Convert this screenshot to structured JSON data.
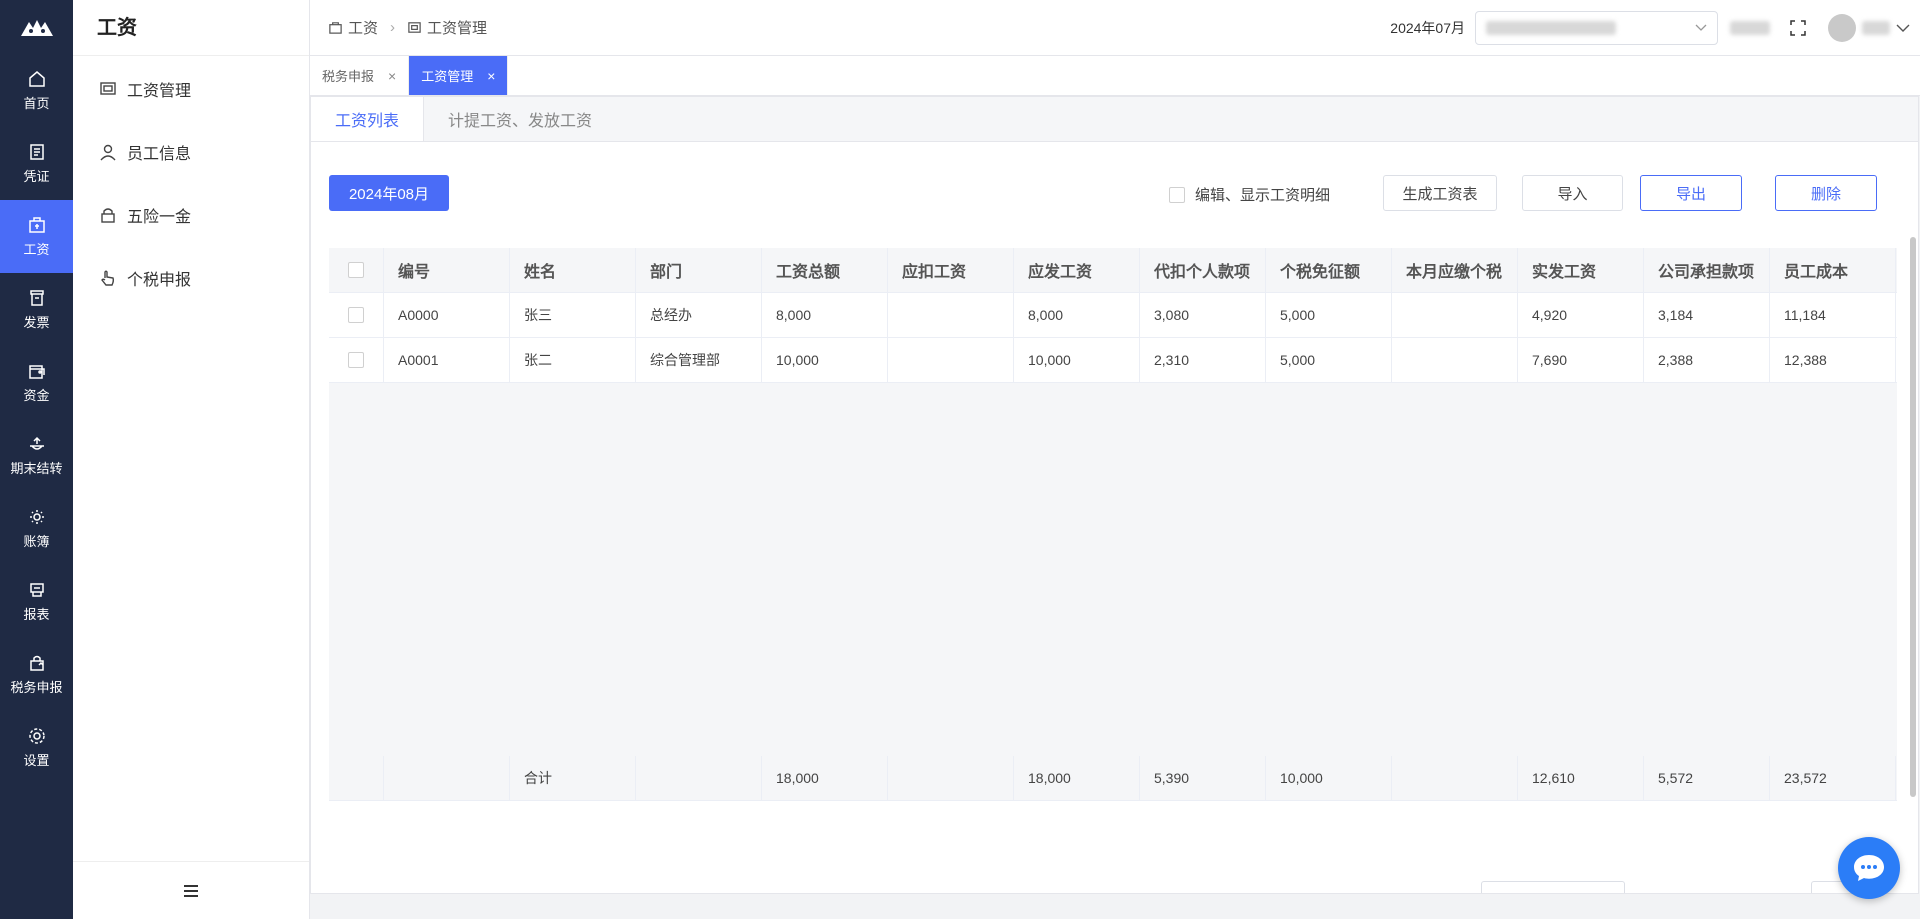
{
  "rail": {
    "items": [
      {
        "label": "首页",
        "icon": "home-icon"
      },
      {
        "label": "凭证",
        "icon": "voucher-icon"
      },
      {
        "label": "工资",
        "icon": "salary-icon"
      },
      {
        "label": "发票",
        "icon": "invoice-icon"
      },
      {
        "label": "资金",
        "icon": "funds-icon"
      },
      {
        "label": "期末结转",
        "icon": "period-close-icon"
      },
      {
        "label": "账簿",
        "icon": "ledger-icon"
      },
      {
        "label": "报表",
        "icon": "report-icon"
      },
      {
        "label": "税务申报",
        "icon": "tax-filing-icon"
      },
      {
        "label": "设置",
        "icon": "settings-icon"
      }
    ],
    "active_index": 2
  },
  "submenu": {
    "title": "工资",
    "items": [
      {
        "label": "工资管理",
        "icon": "payroll-icon"
      },
      {
        "label": "员工信息",
        "icon": "user-icon"
      },
      {
        "label": "五险一金",
        "icon": "lock-icon"
      },
      {
        "label": "个税申报",
        "icon": "hand-pointer-icon"
      }
    ]
  },
  "header": {
    "breadcrumb": [
      "工资",
      "工资管理"
    ],
    "period": "2024年07月"
  },
  "tabs": [
    {
      "label": "税务申报",
      "active": false
    },
    {
      "label": "工资管理",
      "active": true
    }
  ],
  "subtabs": [
    {
      "label": "工资列表",
      "active": true
    },
    {
      "label": "计提工资、发放工资",
      "active": false
    }
  ],
  "toolbar": {
    "month": "2024年08月",
    "checkbox_label": "编辑、显示工资明细",
    "generate_label": "生成工资表",
    "import_label": "导入",
    "export_label": "导出",
    "delete_label": "删除"
  },
  "table": {
    "columns": [
      "编号",
      "姓名",
      "部门",
      "工资总额",
      "应扣工资",
      "应发工资",
      "代扣个人款项",
      "个税免征额",
      "本月应缴个税",
      "实发工资",
      "公司承担款项",
      "员工成本"
    ],
    "rows": [
      [
        "A0000",
        "张三",
        "总经办",
        "8,000",
        "",
        "8,000",
        "3,080",
        "5,000",
        "",
        "4,920",
        "3,184",
        "11,184"
      ],
      [
        "A0001",
        "张二",
        "综合管理部",
        "10,000",
        "",
        "10,000",
        "2,310",
        "5,000",
        "",
        "7,690",
        "2,388",
        "12,388"
      ]
    ],
    "total": [
      "",
      "合计",
      "",
      "18,000",
      "",
      "18,000",
      "5,390",
      "10,000",
      "",
      "12,610",
      "5,572",
      "23,572"
    ]
  },
  "colors": {
    "rail_bg": "#1f2a44",
    "accent": "#4a6cf7",
    "chat_fab": "#2b7df7"
  }
}
